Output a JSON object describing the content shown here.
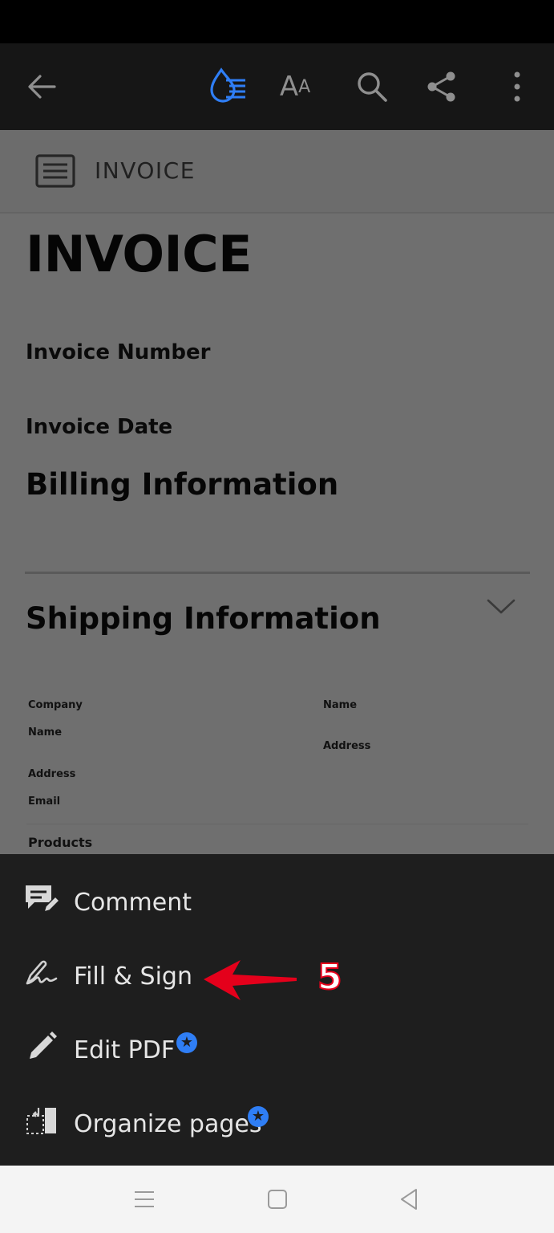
{
  "toolbar": {
    "back_icon": "back-arrow-icon",
    "liquid_mode_icon": "liquid-mode-icon",
    "text_size_label_big": "A",
    "text_size_label_small": "A",
    "search_icon": "search-icon",
    "share_icon": "share-icon",
    "more_icon": "more-vertical-icon",
    "accent_color": "#2f7ef5"
  },
  "doc_header": {
    "title": "INVOICE",
    "icon": "document-list-icon"
  },
  "document": {
    "heading": "INVOICE",
    "invoice_number_label": "Invoice Number",
    "invoice_date_label": "Invoice Date",
    "billing_heading": "Billing Information",
    "shipping_heading": "Shipping Information",
    "left_fields": [
      "Company",
      "Name",
      "Address",
      "Email"
    ],
    "right_fields": [
      "Name",
      "Address"
    ],
    "products_label": "Products"
  },
  "menu": {
    "items": [
      {
        "label": "Comment",
        "icon": "comment-icon",
        "premium": false
      },
      {
        "label": "Fill & Sign",
        "icon": "fill-sign-icon",
        "premium": false
      },
      {
        "label": "Edit PDF",
        "icon": "pencil-icon",
        "premium": true
      },
      {
        "label": "Organize pages",
        "icon": "organize-pages-icon",
        "premium": true
      }
    ],
    "premium_badge_glyph": "★"
  },
  "annotation": {
    "step_number": "5",
    "color": "#e4001b"
  },
  "navbar": {
    "menu_icon": "recents-icon",
    "home_icon": "home-icon",
    "back_icon": "nav-back-icon"
  }
}
